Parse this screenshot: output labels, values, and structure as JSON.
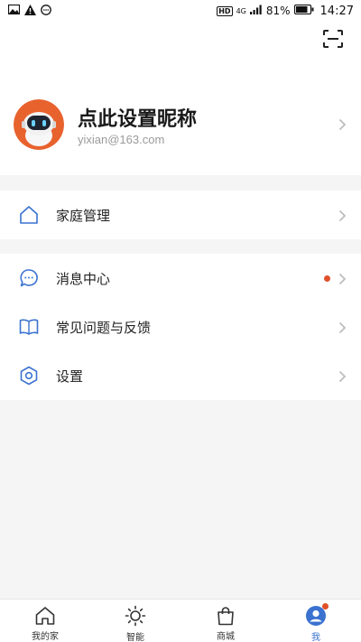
{
  "status_bar": {
    "battery": "81%",
    "time": "14:27",
    "hd": "HD",
    "network": "4G"
  },
  "profile": {
    "nickname": "点此设置昵称",
    "email": "yixian@163.com",
    "avatar_color": "#e8622e"
  },
  "menu_groups": [
    {
      "items": [
        {
          "label": "家庭管理",
          "icon": "home-outline-icon"
        }
      ]
    },
    {
      "items": [
        {
          "label": "消息中心",
          "icon": "message-bubble-icon",
          "badge": true
        },
        {
          "label": "常见问题与反馈",
          "icon": "book-icon"
        },
        {
          "label": "设置",
          "icon": "settings-hexagon-icon"
        }
      ]
    }
  ],
  "tab_bar": {
    "tabs": [
      {
        "label": "我的家",
        "icon": "home-icon"
      },
      {
        "label": "智能",
        "icon": "sun-icon"
      },
      {
        "label": "商城",
        "icon": "shopping-bag-icon"
      },
      {
        "label": "我",
        "icon": "profile-icon",
        "active": true,
        "badge": true
      }
    ]
  },
  "colors": {
    "accent": "#3a72d0",
    "badge": "#e0502a",
    "background": "#f5f5f5"
  }
}
